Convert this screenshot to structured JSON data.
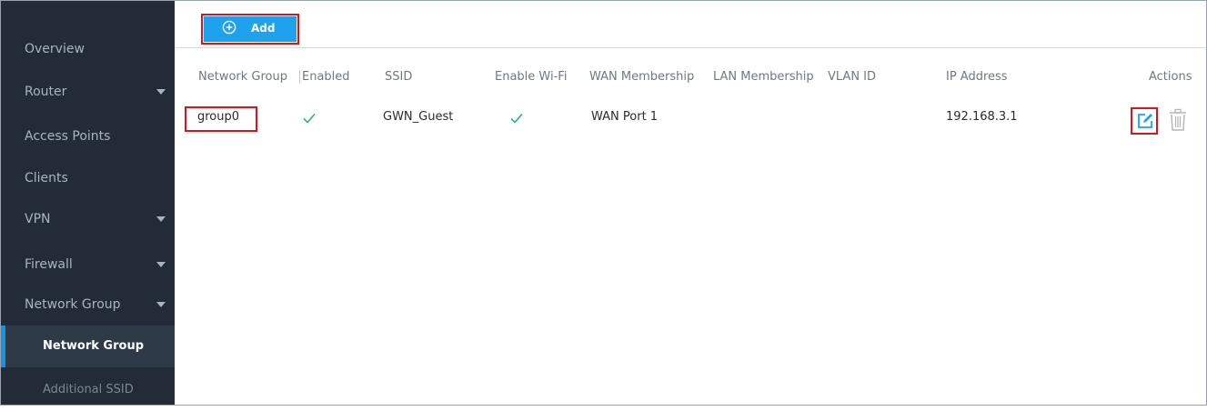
{
  "sidebar": {
    "items": [
      {
        "label": "Overview",
        "has_caret": false
      },
      {
        "label": "Router",
        "has_caret": true
      },
      {
        "label": "Access Points",
        "has_caret": false
      },
      {
        "label": "Clients",
        "has_caret": false
      },
      {
        "label": "VPN",
        "has_caret": true
      },
      {
        "label": "Firewall",
        "has_caret": true
      },
      {
        "label": "Network Group",
        "has_caret": true
      }
    ],
    "subitems": [
      {
        "label": "Network Group",
        "active": true
      },
      {
        "label": "Additional SSID",
        "active": false
      }
    ]
  },
  "toolbar": {
    "add_label": "Add",
    "add_icon": "plus-circle-icon",
    "accent": "#1ea2ee",
    "highlight": "#d8141c"
  },
  "table": {
    "columns": [
      "Network Group",
      "Enabled",
      "SSID",
      "Enable Wi-Fi",
      "WAN Membership",
      "LAN Membership",
      "VLAN ID",
      "IP Address",
      "Actions"
    ],
    "rows": [
      {
        "network_group": "group0",
        "enabled": "check-icon",
        "ssid": "GWN_Guest",
        "enable_wifi": "check-icon",
        "wan_membership": "WAN Port 1",
        "lan_membership": "",
        "vlan_id": "",
        "ip_address": "192.168.3.1",
        "actions": [
          "edit-icon",
          "trash-icon"
        ]
      }
    ]
  },
  "colors": {
    "sidebar_bg": "#222b37",
    "active_item_bg": "#2f3a48",
    "check": "#31b07c"
  }
}
